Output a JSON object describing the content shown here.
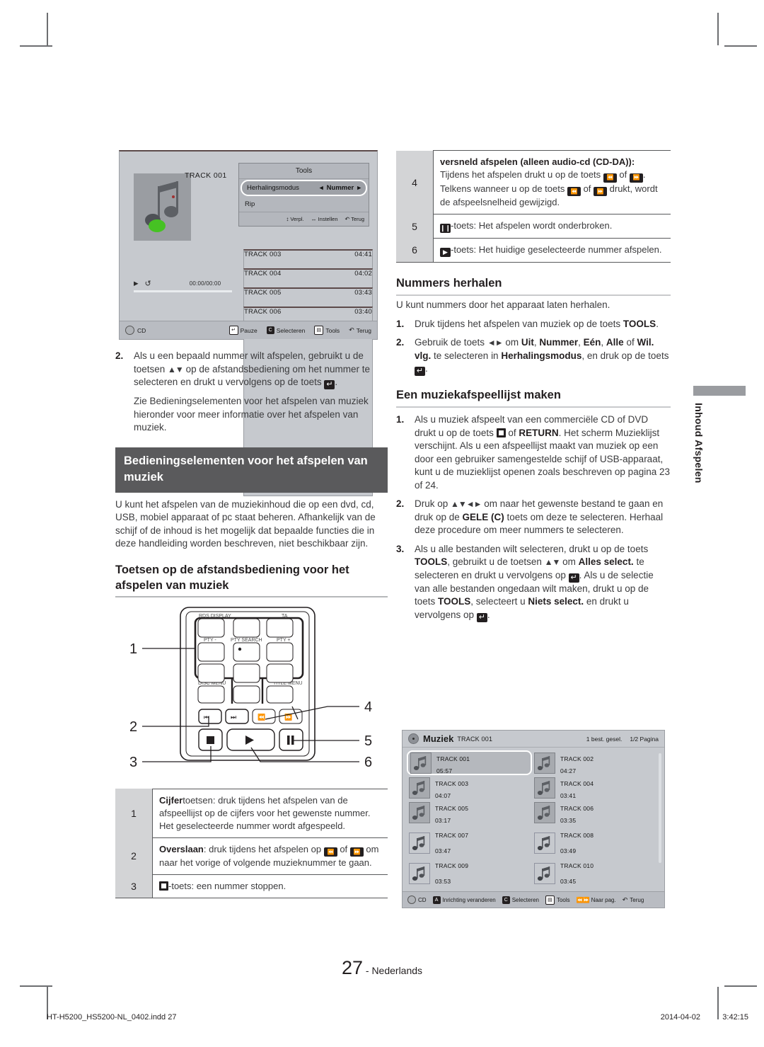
{
  "page": {
    "number": "27",
    "language": "Nederlands",
    "side_tab": "Inhoud Afspelen",
    "footer_file": "HT-H5200_HS5200-NL_0402.indd   27",
    "footer_date": "2014-04-02",
    "footer_time": "3:42:15"
  },
  "screenshot_player": {
    "track_title": "TRACK 001",
    "timecode": "00:00/00:00",
    "tools_popup": {
      "title": "Tools",
      "selected_row_label": "Herhalingsmodus",
      "selected_row_value": "Nummer",
      "row2_label": "Rip",
      "footer": [
        {
          "icon": "updown-arrow-icon",
          "label": "Verpl."
        },
        {
          "icon": "leftright-arrow-icon",
          "label": "Instellen"
        },
        {
          "icon": "return-icon",
          "label": "Terug"
        }
      ]
    },
    "tracks": [
      {
        "name": "TRACK 003",
        "time": "04:41"
      },
      {
        "name": "TRACK 004",
        "time": "04:02"
      },
      {
        "name": "TRACK 005",
        "time": "03:43"
      },
      {
        "name": "TRACK 006",
        "time": "03:40"
      }
    ],
    "status_bar": {
      "source": "CD",
      "actions": [
        {
          "key": "E",
          "label": "Pauze"
        },
        {
          "key": "C",
          "label": "Selecteren"
        },
        {
          "key": "T",
          "label": "Tools"
        },
        {
          "key": "R",
          "label": "Terug"
        }
      ]
    }
  },
  "left_column": {
    "step2_number": "2.",
    "step2_text_a": "Als u een bepaald nummer wilt afspelen, gebruikt u de toetsen ",
    "step2_arrows": "▲▼",
    "step2_text_b": " op de afstandsbediening om het nummer te selecteren en drukt u vervolgens op de toets ",
    "step2_text_c": ".",
    "step2_note": "Zie Bedieningselementen voor het afspelen van muziek hieronder voor meer informatie over het afspelen van muziek.",
    "heading_bar": "Bedieningselementen voor het afspelen van muziek",
    "intro": "U kunt het afspelen van de muziekinhoud die op een dvd, cd, USB, mobiel apparaat of pc staat beheren. Afhankelijk van de schijf of de inhoud is het mogelijk dat bepaalde functies die in deze handleiding worden beschreven, niet beschikbaar zijn.",
    "subheading": "Toetsen op de afstandsbediening voor het afspelen van muziek",
    "remote": {
      "labels": [
        "RDS DISPLAY",
        "TA",
        "PTY -",
        "PTY SEARCH",
        "PTY +",
        "DISC MENU",
        "TITLE MENU"
      ],
      "callouts": [
        "1",
        "2",
        "3",
        "4",
        "5",
        "6"
      ]
    },
    "table_rows": [
      {
        "index": "1",
        "bold": "Cijfer",
        "text": "toetsen: druk tijdens het afspelen van de afspeellijst op de cijfers voor het gewenste nummer. Het geselecteerde nummer wordt afgespeeld."
      },
      {
        "index": "2",
        "bold": "Overslaan",
        "text_a": ": druk tijdens het afspelen op ",
        "text_b": " of ",
        "text_c": " om naar het vorige of volgende muzieknummer te gaan."
      },
      {
        "index": "3",
        "text": "-toets: een nummer stoppen."
      }
    ]
  },
  "right_column": {
    "table_rows": [
      {
        "index": "4",
        "bold": "versneld afspelen (alleen audio-cd (CD-DA)):",
        "text_a": "Tijdens het afspelen drukt u op de toets ",
        "text_b": " of ",
        "text_c": ". Telkens wanneer u op de toets ",
        "text_d": " of ",
        "text_e": " drukt, wordt de afspeelsnelheid gewijzigd."
      },
      {
        "index": "5",
        "text": "-toets: Het afspelen wordt onderbroken."
      },
      {
        "index": "6",
        "text": "-toets: Het huidige geselecteerde nummer afspelen."
      }
    ],
    "section_repeat": {
      "heading": "Nummers herhalen",
      "intro": "U kunt nummers door het apparaat laten herhalen.",
      "step1_number": "1.",
      "step1_text": "Druk tijdens het afspelen van muziek op de toets ",
      "step1_bold": "TOOLS",
      "step1_end": ".",
      "step2_number": "2.",
      "step2_a": "Gebruik de toets ",
      "step2_arrows": "◄►",
      "step2_b": " om ",
      "step2_opt1": "Uit",
      "step2_opt2": "Nummer",
      "step2_opt3": "Eén",
      "step2_opt4": "Alle",
      "step2_opt5": "Wil. vlg.",
      "step2_c": " te selecteren in ",
      "step2_bold2": "Herhalingsmodus",
      "step2_d": ", en druk op de toets ",
      "step2_e": "."
    },
    "section_playlist": {
      "heading": "Een muziekafspeellijst maken",
      "step1_number": "1.",
      "step1_a": "Als u muziek afspeelt van een commerciële CD of DVD drukt u op de toets ",
      "step1_b": " of ",
      "step1_bold": "RETURN",
      "step1_c": ". Het scherm Muzieklijst verschijnt. Als u een afspeellijst maakt van muziek op een door een gebruiker samengestelde schijf of USB-apparaat, kunt u de muzieklijst openen zoals beschreven op pagina 23 of 24.",
      "step2_number": "2.",
      "step2_a": "Druk op ",
      "step2_arrows": "▲▼◄►",
      "step2_b": " om naar het gewenste bestand te gaan en druk op de ",
      "step2_bold": "GELE (C)",
      "step2_c": " toets om deze te selecteren. Herhaal deze procedure om meer nummers te selecteren.",
      "step3_number": "3.",
      "step3_a": "Als u alle bestanden wilt selecteren, drukt u op de toets ",
      "step3_bold1": "TOOLS",
      "step3_b": ", gebruikt u de toetsen ",
      "step3_arrows": "▲▼",
      "step3_c": " om ",
      "step3_bold2": "Alles select.",
      "step3_d": " te selecteren en drukt u vervolgens op ",
      "step3_e": ". Als u de selectie van alle bestanden ongedaan wilt maken, drukt u op de toets ",
      "step3_bold3": "TOOLS",
      "step3_f": ", selecteert u ",
      "step3_bold4": "Niets select.",
      "step3_g": " en drukt u vervolgens op ",
      "step3_h": "."
    }
  },
  "screenshot_playlist": {
    "header": {
      "title": "Muziek",
      "subtitle": "TRACK 001",
      "selected_count": "1 best. gesel.",
      "page_indicator": "1/2 Pagina"
    },
    "items": [
      {
        "name": "TRACK 001",
        "time": "05:57",
        "selected": true,
        "shaded": true
      },
      {
        "name": "TRACK 002",
        "time": "04:27",
        "selected": false,
        "shaded": true
      },
      {
        "name": "TRACK 003",
        "time": "04:07",
        "selected": false,
        "shaded": true
      },
      {
        "name": "TRACK 004",
        "time": "03:41",
        "selected": false,
        "shaded": true
      },
      {
        "name": "TRACK 005",
        "time": "03:17",
        "selected": false,
        "shaded": true
      },
      {
        "name": "TRACK 006",
        "time": "03:35",
        "selected": false,
        "shaded": true
      },
      {
        "name": "TRACK 007",
        "time": "03:47",
        "selected": false,
        "shaded": false
      },
      {
        "name": "TRACK 008",
        "time": "03:49",
        "selected": false,
        "shaded": false
      },
      {
        "name": "TRACK 009",
        "time": "03:53",
        "selected": false,
        "shaded": false
      },
      {
        "name": "TRACK 010",
        "time": "03:45",
        "selected": false,
        "shaded": false
      }
    ],
    "footer": {
      "source": "CD",
      "actions": [
        {
          "key": "A",
          "label": "Inrichting veranderen"
        },
        {
          "key": "C",
          "label": "Selecteren"
        },
        {
          "key": "T",
          "label": "Tools"
        },
        {
          "key": "P",
          "label": "Naar pag."
        },
        {
          "key": "R",
          "label": "Terug"
        }
      ]
    }
  },
  "colors": {
    "heading_bar": "#5a5a5c",
    "screen_bg": "#c6c9ce",
    "rule": "#58595b"
  }
}
